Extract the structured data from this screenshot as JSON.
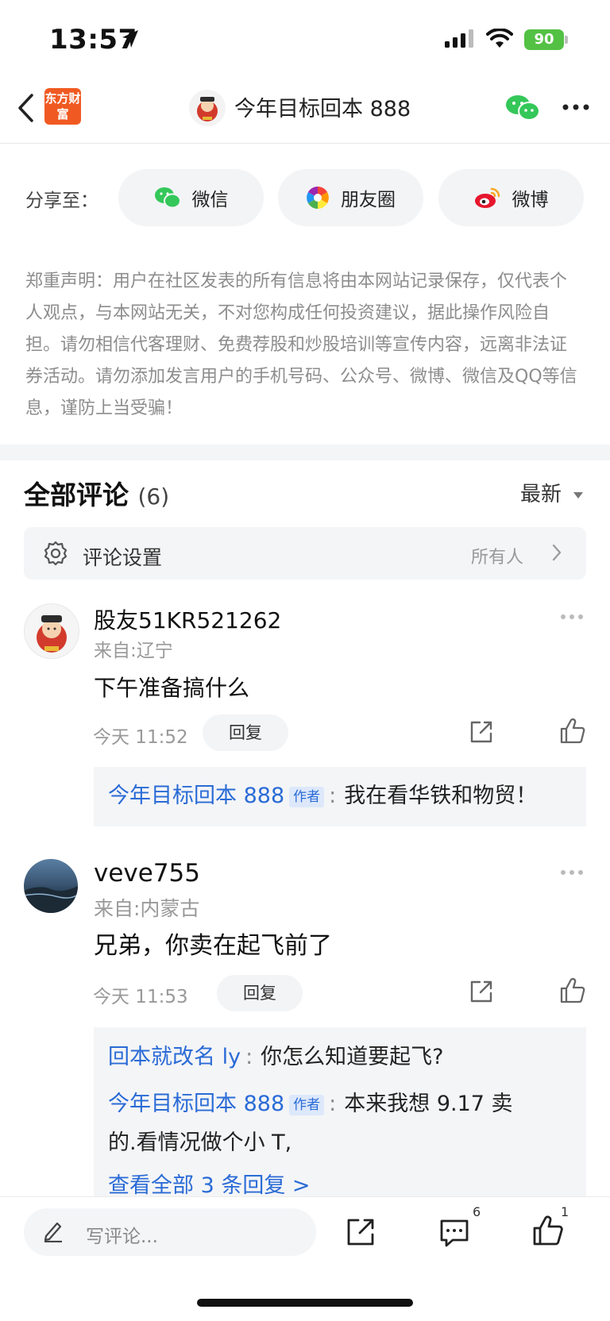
{
  "status": {
    "time": "13:57",
    "battery": "90"
  },
  "nav": {
    "title": "今年目标回本 888",
    "logo_text": "东方财富"
  },
  "share": {
    "label": "分享至：",
    "options": [
      {
        "label": "微信",
        "icon": "wechat-icon"
      },
      {
        "label": "朋友圈",
        "icon": "moments-icon"
      },
      {
        "label": "微博",
        "icon": "weibo-icon"
      }
    ]
  },
  "disclaimer": "郑重声明：用户在社区发表的所有信息将由本网站记录保存，仅代表个人观点，与本网站无关，不对您构成任何投资建议，据此操作风险自担。请勿相信代客理财、免费荐股和炒股培训等宣传内容，远离非法证券活动。请勿添加发言用户的手机号码、公众号、微博、微信及QQ等信息，谨防上当受骗！",
  "comments_header": {
    "title": "全部评论",
    "count": "(6)",
    "sort": "最新"
  },
  "settings": {
    "label": "评论设置",
    "value": "所有人"
  },
  "comments": [
    {
      "user": "股友51KR521262",
      "location": "来自:辽宁",
      "text": "下午准备搞什么",
      "time": "今天 11:52",
      "reply_label": "回复",
      "replies": [
        {
          "name": "今年目标回本 888",
          "tag": "作者",
          "text": "我在看华铁和物贸！"
        }
      ]
    },
    {
      "user": "veve755",
      "location": "来自:内蒙古",
      "text": "兄弟，你卖在起飞前了",
      "time": "今天 11:53",
      "reply_label": "回复",
      "replies": [
        {
          "name": "回本就改名 ly",
          "text": "你怎么知道要起飞?"
        },
        {
          "name": "今年目标回本 888",
          "tag": "作者",
          "text": "本来我想 9.17 卖",
          "text2": "的.看情况做个小 T,"
        }
      ],
      "view_all": "查看全部 3 条回复 >"
    }
  ],
  "bottom": {
    "placeholder": "写评论...",
    "comment_count": "6",
    "like_count": "1"
  },
  "colors": {
    "accent": "#2a6bd6",
    "logo": "#f05a22",
    "battery": "#53c144"
  }
}
